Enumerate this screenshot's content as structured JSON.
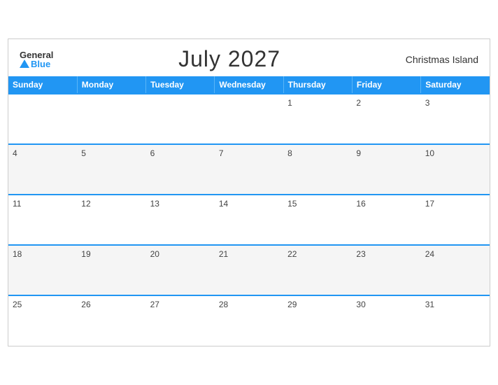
{
  "header": {
    "logo_general": "General",
    "logo_blue": "Blue",
    "title": "July 2027",
    "location": "Christmas Island"
  },
  "calendar": {
    "days_of_week": [
      "Sunday",
      "Monday",
      "Tuesday",
      "Wednesday",
      "Thursday",
      "Friday",
      "Saturday"
    ],
    "weeks": [
      [
        "",
        "",
        "",
        "",
        "1",
        "2",
        "3"
      ],
      [
        "4",
        "5",
        "6",
        "7",
        "8",
        "9",
        "10"
      ],
      [
        "11",
        "12",
        "13",
        "14",
        "15",
        "16",
        "17"
      ],
      [
        "18",
        "19",
        "20",
        "21",
        "22",
        "23",
        "24"
      ],
      [
        "25",
        "26",
        "27",
        "28",
        "29",
        "30",
        "31"
      ]
    ]
  }
}
